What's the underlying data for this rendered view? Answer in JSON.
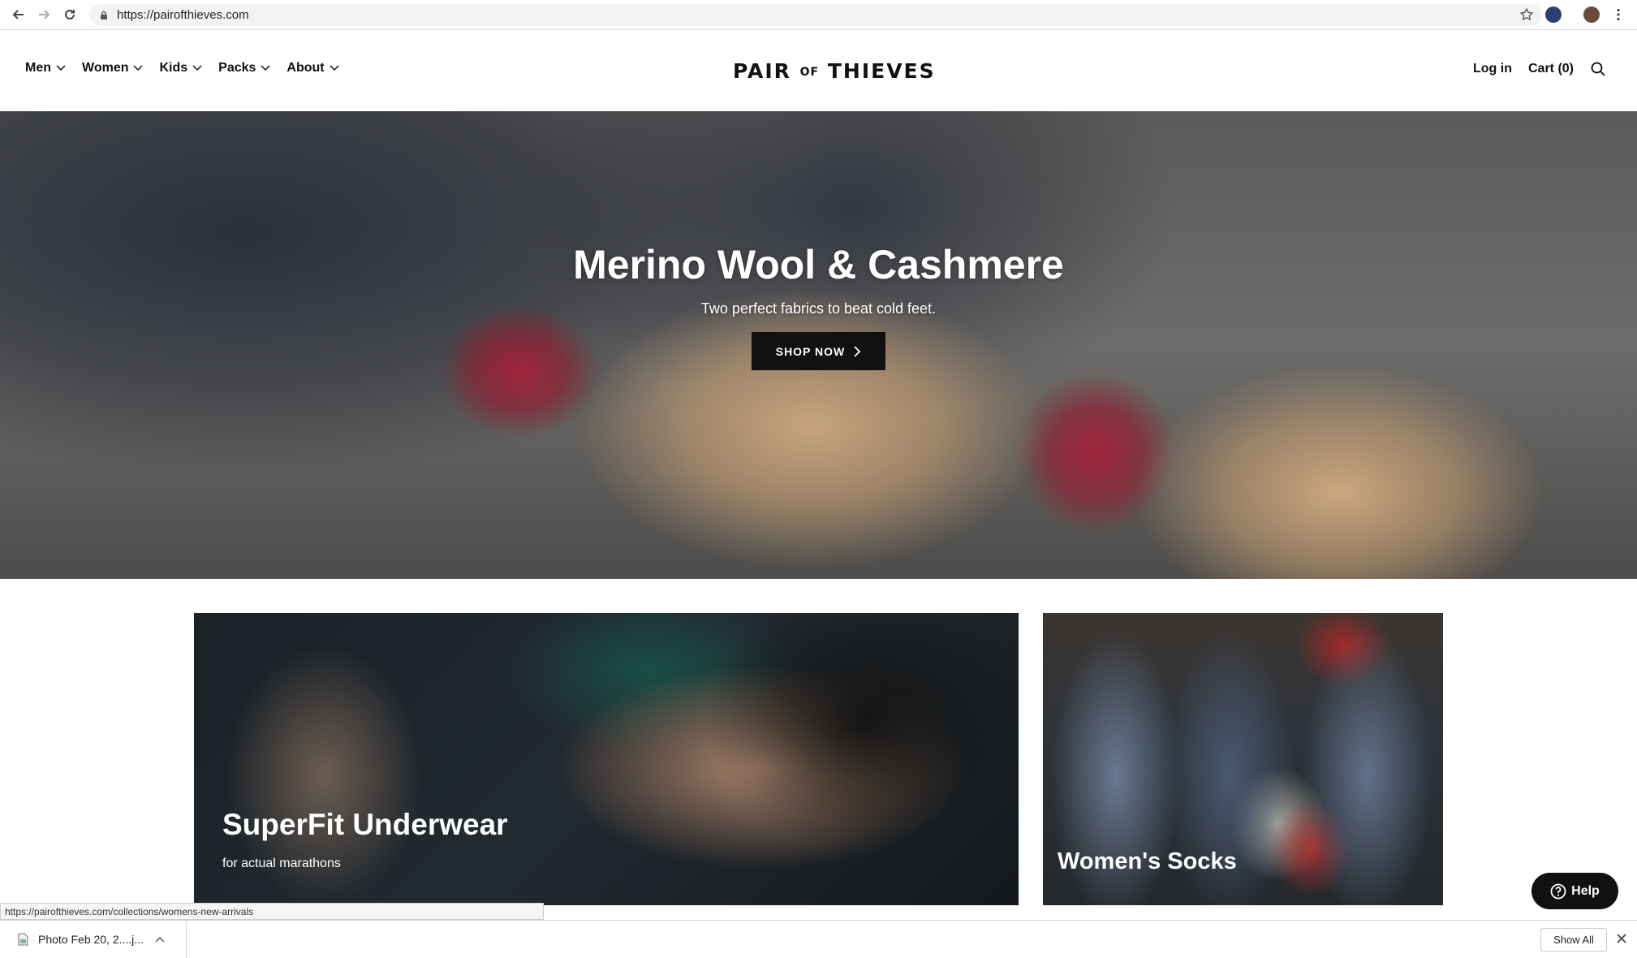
{
  "browser": {
    "url": "https://pairofthieves.com",
    "status_url": "https://pairofthieves.com/collections/womens-new-arrivals"
  },
  "header": {
    "nav": [
      "Men",
      "Women",
      "Kids",
      "Packs",
      "About"
    ],
    "logo_left": "PAIR",
    "logo_of": "OF",
    "logo_right": "THIEVES",
    "login": "Log in",
    "cart": "Cart (0)"
  },
  "hero": {
    "title": "Merino Wool & Cashmere",
    "subtitle": "Two perfect fabrics to beat cold feet.",
    "cta": "SHOP NOW"
  },
  "tiles": {
    "underwear_title": "SuperFit Underwear",
    "underwear_sub": "for actual marathons",
    "socks_title": "Women's Socks"
  },
  "help": {
    "label": "Help"
  },
  "downloads": {
    "file_name": "Photo Feb 20, 2....j...",
    "show_all": "Show All"
  },
  "colors": {
    "accent": "#111111",
    "background": "#ffffff"
  }
}
